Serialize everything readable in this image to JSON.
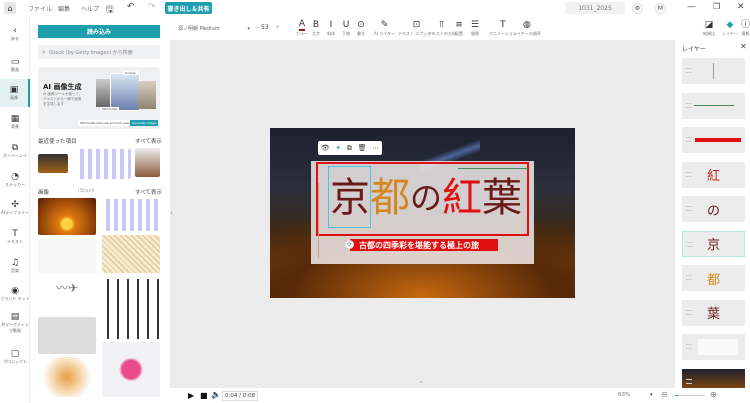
{
  "topbar": {
    "menu": [
      "ファイル",
      "編集",
      "ヘルプ"
    ],
    "export_label": "書き出し＆共有",
    "project_name": "1031_2025",
    "avatar": "M"
  },
  "rail": [
    {
      "icon": "back-icon",
      "glyph": "‹",
      "label": "戻る"
    },
    {
      "icon": "video-icon",
      "glyph": "▭",
      "label": "動画"
    },
    {
      "icon": "image-icon",
      "glyph": "▣",
      "label": "画像"
    },
    {
      "icon": "background-icon",
      "glyph": "▦",
      "label": "背景"
    },
    {
      "icon": "overlay-icon",
      "glyph": "⧉",
      "label": "オーバーレイ"
    },
    {
      "icon": "sticker-icon",
      "glyph": "◔",
      "label": "ステッカー"
    },
    {
      "icon": "ai-library-icon",
      "glyph": "✣",
      "label": "AIライブラリー"
    },
    {
      "icon": "text-icon",
      "glyph": "T",
      "label": "テキスト"
    },
    {
      "icon": "music-icon",
      "glyph": "♫",
      "label": "音楽"
    },
    {
      "icon": "brand-kit-icon",
      "glyph": "◉",
      "label": "ブランド キット"
    },
    {
      "icon": "ai-marketing-icon",
      "glyph": "▤",
      "label": "AIマーケティング動画"
    },
    {
      "icon": "project-icon",
      "glyph": "▢",
      "label": "プロジェクト"
    }
  ],
  "panel": {
    "load_label": "読み込み",
    "search_placeholder": "iStock (by Getty Images) から検索",
    "ai": {
      "title": "AI 画像生成",
      "desc": "AI 画像ツールを使って、テキストから一瞬で画像を生成します",
      "prompt": "Minimalist skincare product scene",
      "button": "Generate Image",
      "tag1": "Unique",
      "tag2": "Minimalist"
    },
    "recent_title": "最近使った項目",
    "see_all": "すべて表示",
    "images_title": "画像",
    "images_tab2": "iStock"
  },
  "toolbar": {
    "font": "源ノ明朝 Medium",
    "size": "53",
    "minus": "−",
    "plus": "+",
    "tools": [
      {
        "icon": "color-icon",
        "glyph": "A",
        "label": "カラー"
      },
      {
        "icon": "bold-icon",
        "glyph": "B",
        "label": "太字"
      },
      {
        "icon": "italic-icon",
        "glyph": "I",
        "label": "斜体"
      },
      {
        "icon": "underline-icon",
        "glyph": "U",
        "label": "下線"
      },
      {
        "icon": "style-icon",
        "glyph": "⊙",
        "label": "書式"
      },
      {
        "icon": "ai-writer-icon",
        "glyph": "✎",
        "label": "AI ライター"
      },
      {
        "icon": "text-effect-icon",
        "glyph": "⊡",
        "label": "テキスト エフェクト"
      },
      {
        "icon": "text-direction-icon",
        "glyph": "⫪",
        "label": "テキストの方向"
      },
      {
        "icon": "align-icon",
        "glyph": "≡",
        "label": "配置"
      },
      {
        "icon": "spacing-icon",
        "glyph": "☰",
        "label": "間隔"
      },
      {
        "icon": "animation-icon",
        "glyph": "T",
        "label": "アニメーション"
      },
      {
        "icon": "layer-order-icon",
        "glyph": "◍",
        "label": "レイヤーの順序"
      }
    ],
    "right": [
      {
        "icon": "aspect-ratio-icon",
        "glyph": "◪",
        "label": "縦横比"
      },
      {
        "icon": "layer-icon",
        "glyph": "◆",
        "label": "レイヤー"
      },
      {
        "icon": "info-icon",
        "glyph": "ⓘ",
        "label": "情報"
      }
    ]
  },
  "canvas": {
    "title_chars": [
      "京",
      "都",
      "の",
      "紅",
      "葉"
    ],
    "subtitle": "古都の四季彩を堪能する極上の旅",
    "colors": {
      "dark": "#6b1a1a",
      "orange": "#d4871e",
      "red": "#e01010"
    }
  },
  "layers": {
    "title": "レイヤー",
    "items": [
      "",
      "",
      "",
      "紅",
      "の",
      "京",
      "都",
      "葉",
      "",
      ""
    ]
  },
  "bottom": {
    "time": "0:04 / 0:08",
    "zoom": "63%"
  }
}
